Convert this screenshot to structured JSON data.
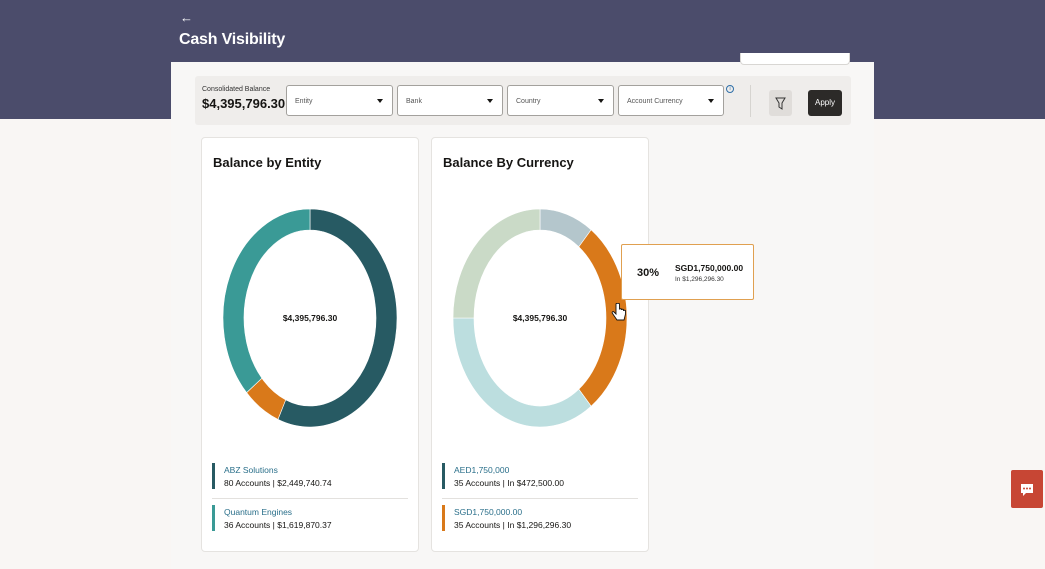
{
  "header": {
    "back_symbol": "←",
    "title": "Cash Visibility"
  },
  "filters": {
    "consolidated_label": "Consolidated Balance",
    "consolidated_value": "$4,395,796.30",
    "entity": "Entity",
    "bank": "Bank",
    "country": "Country",
    "account_currency": "Account Currency",
    "apply_label": "Apply"
  },
  "entity_card": {
    "title": "Balance by Entity",
    "center_value": "$4,395,796.30",
    "legend": [
      {
        "name": "ABZ Solutions",
        "detail": "80 Accounts | $2,449,740.74",
        "color": "#275a63"
      },
      {
        "name": "Quantum Engines",
        "detail": "36 Accounts | $1,619,870.37",
        "color": "#3a9a96"
      }
    ]
  },
  "currency_card": {
    "title": "Balance By Currency",
    "center_value": "$4,395,796.30",
    "legend": [
      {
        "name": "AED1,750,000",
        "detail": "35 Accounts | In $472,500.00",
        "color": "#275a63"
      },
      {
        "name": "SGD1,750,000.00",
        "detail": "35 Accounts | In $1,296,296.30",
        "color": "#d9791a"
      }
    ]
  },
  "tooltip": {
    "percent": "30%",
    "value": "SGD1,750,000.00",
    "sub": "In $1,296,296.30"
  },
  "chart_data": [
    {
      "type": "pie",
      "title": "Balance by Entity",
      "center_label": "$4,395,796.30",
      "categories": [
        "ABZ Solutions",
        "Unlabeled orange segment",
        "Quantum Engines"
      ],
      "values": [
        0.56,
        0.07,
        0.37
      ],
      "colors": [
        "#275a63",
        "#d9791a",
        "#3a9a96"
      ]
    },
    {
      "type": "pie",
      "title": "Balance By Currency",
      "center_label": "$4,395,796.30",
      "categories": [
        "Unlabeled grey-blue segment",
        "SGD1,750,000.00",
        "Unlabeled light-blue segment",
        "Unlabeled light-green segment"
      ],
      "values": [
        0.1,
        0.3,
        0.35,
        0.25
      ],
      "colors": [
        "#b4c6cc",
        "#d9791a",
        "#bcdedf",
        "#cadac7"
      ]
    }
  ]
}
